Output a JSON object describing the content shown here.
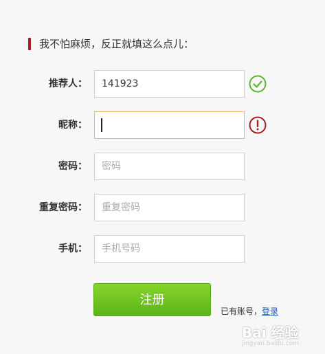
{
  "heading": "我不怕麻烦，反正就填这么点儿：",
  "form": {
    "referrer": {
      "label": "推荐人：",
      "value": "141923",
      "status": "valid"
    },
    "nickname": {
      "label": "昵称：",
      "value": "",
      "status": "error"
    },
    "password": {
      "label": "密码：",
      "placeholder": "密码"
    },
    "confirm_password": {
      "label": "重复密码：",
      "placeholder": "重复密码"
    },
    "phone": {
      "label": "手机：",
      "placeholder": "手机号码"
    }
  },
  "submit_label": "注册",
  "login_hint": "已有账号，",
  "login_link": "登录",
  "watermark": {
    "logo": "Bai 经验",
    "sub": "jingyan.baidu.com"
  },
  "colors": {
    "valid": "#5cb531",
    "error": "#a3201f",
    "button": "#6cc420",
    "focus_border": "#e9b567"
  }
}
